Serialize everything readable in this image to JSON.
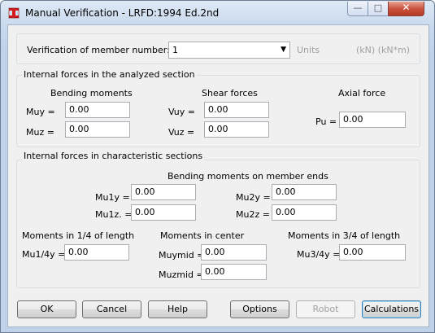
{
  "window": {
    "title": "Manual Verification - LRFD:1994 Ed.2nd",
    "min_icon": "minimize-icon",
    "max_icon": "maximize-icon",
    "close_icon": "close-icon"
  },
  "member": {
    "label": "Verification of member number:",
    "value": "1",
    "units_label": "Units",
    "units_value": "(kN) (kN*m)"
  },
  "internal": {
    "group_label": "Internal forces in the analyzed section",
    "bending_title": "Bending moments",
    "shear_title": "Shear forces",
    "axial_title": "Axial force",
    "muy_label": "Muy =",
    "muy_value": "0.00",
    "muz_label": "Muz =",
    "muz_value": "0.00",
    "vuy_label": "Vuy =",
    "vuy_value": "0.00",
    "vuz_label": "Vuz =",
    "vuz_value": "0.00",
    "pu_label": "Pu =",
    "pu_value": "0.00"
  },
  "characteristic": {
    "group_label": "Internal forces in characteristic sections",
    "ends_title": "Bending moments on member ends",
    "mu1y_label": "Mu1y =",
    "mu1y_value": "0.00",
    "mu1z_label": "Mu1z. =",
    "mu1z_value": "0.00",
    "mu2y_label": "Mu2y =",
    "mu2y_value": "0.00",
    "mu2z_label": "Mu2z =",
    "mu2z_value": "0.00",
    "quarter_title": "Moments in 1/4 of length",
    "mu14y_label": "Mu1/4y =",
    "mu14y_value": "0.00",
    "center_title": "Moments in center",
    "muymid_label": "Muymid =",
    "muymid_value": "0.00",
    "muzmid_label": "Muzmid =",
    "muzmid_value": "0.00",
    "threequarter_title": "Moments in 3/4 of length",
    "mu34y_label": "Mu3/4y =",
    "mu34y_value": "0.00"
  },
  "buttons": {
    "ok": "OK",
    "cancel": "Cancel",
    "help": "Help",
    "options": "Options",
    "robot": "Robot",
    "calculations": "Calculations"
  }
}
